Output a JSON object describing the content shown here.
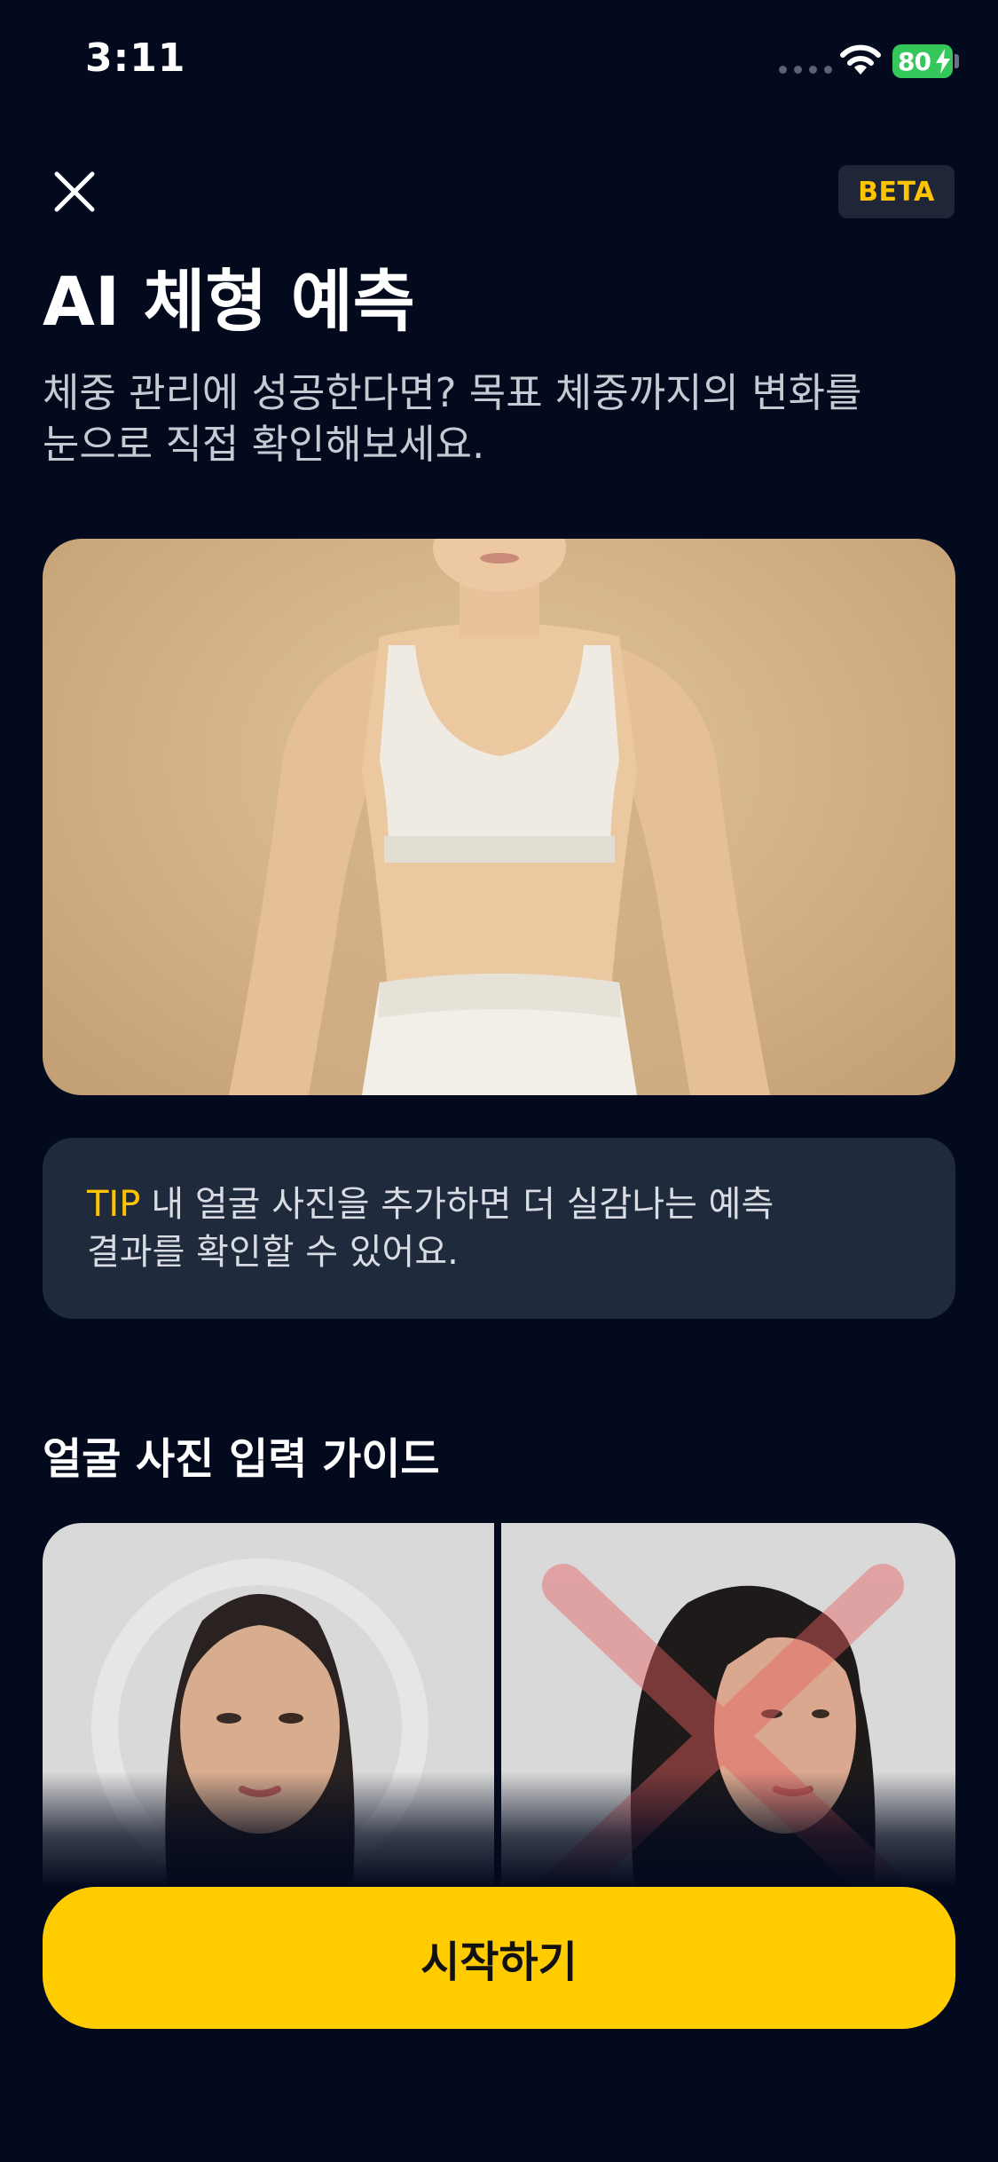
{
  "status_bar": {
    "time": "3:11",
    "battery": "80"
  },
  "header": {
    "badge": "BETA",
    "title": "AI 체형 예측",
    "subtitle_line1": "체중 관리에 성공한다면? 목표 체중까지의 변화를",
    "subtitle_line2": "눈으로 직접 확인해보세요."
  },
  "tip": {
    "label": "TIP",
    "text_line1": "내 얼굴 사진을 추가하면 더 실감나는 예측",
    "text_line2": "결과를 확인할 수 있어요."
  },
  "guide": {
    "title": "얼굴 사진 입력 가이드"
  },
  "actions": {
    "start_label": "시작하기"
  },
  "colors": {
    "background": "#030a1e",
    "accent": "#ffcc00",
    "tip_box": "#1f2a3d",
    "badge_text": "#ffc400"
  },
  "icons": {
    "close": "close-icon",
    "wifi": "wifi-icon",
    "battery": "battery-icon"
  }
}
